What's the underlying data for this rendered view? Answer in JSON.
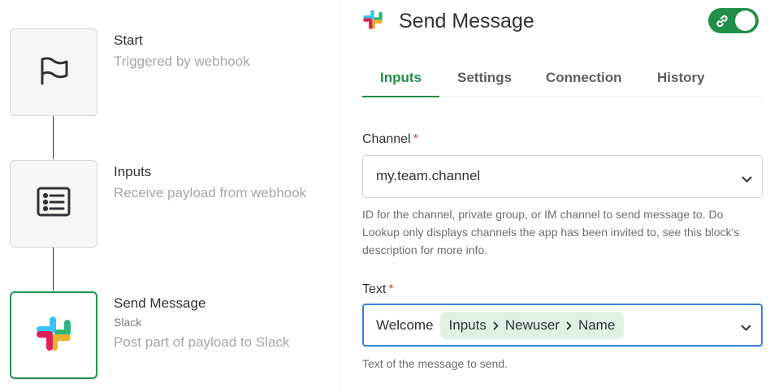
{
  "flow": {
    "nodes": [
      {
        "title": "Start",
        "subtitle": "Triggered by webhook",
        "icon": "flag-icon"
      },
      {
        "title": "Inputs",
        "subtitle": "Receive payload from webhook",
        "icon": "list-icon"
      },
      {
        "title": "Send Message",
        "app": "Slack",
        "subtitle": "Post part of payload to Slack",
        "icon": "slack-logo-icon"
      }
    ]
  },
  "panel": {
    "title": "Send Message",
    "enabled": true,
    "tabs": [
      {
        "label": "Inputs",
        "active": true
      },
      {
        "label": "Settings",
        "active": false
      },
      {
        "label": "Connection",
        "active": false
      },
      {
        "label": "History",
        "active": false
      }
    ],
    "channel": {
      "label": "Channel",
      "required_mark": "*",
      "value": "my.team.channel",
      "help": "ID for the channel, private group, or IM channel to send message to. Do Lookup only displays channels the app has been invited to, see this block's description for more info."
    },
    "text": {
      "label": "Text",
      "required_mark": "*",
      "prefix": "Welcome",
      "token": [
        "Inputs",
        "Newuser",
        "Name"
      ],
      "help": "Text of the message to send."
    }
  },
  "colors": {
    "accent": "#1f8f4a",
    "focus": "#3b7fd8",
    "required": "#d14a3c",
    "token_bg": "#dff1e3"
  }
}
